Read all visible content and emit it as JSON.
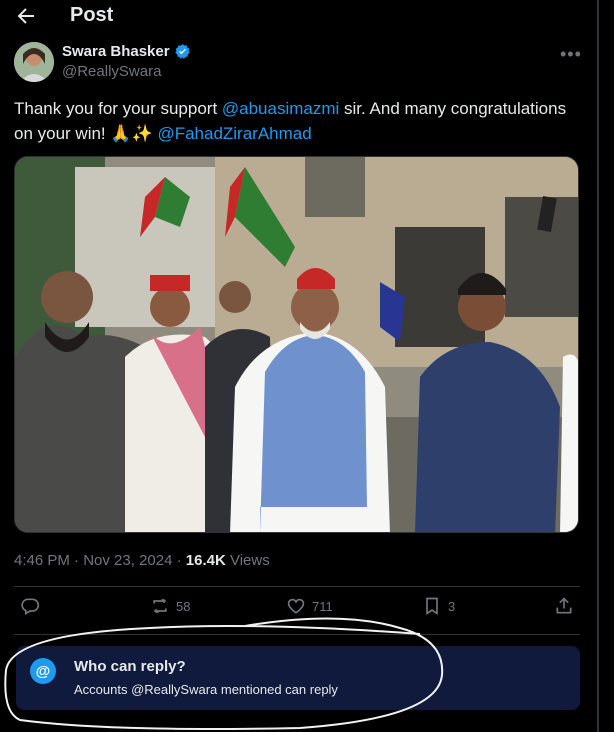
{
  "header": {
    "title": "Post",
    "back_icon": "arrow-left-icon"
  },
  "author": {
    "name": "Swara Bhasker",
    "handle": "@ReallySwara",
    "verified": true
  },
  "tweet": {
    "text_1": "Thank you for your support ",
    "mention_1": "@abuasimazmi",
    "text_2": " sir. And many congratulations on your win! 🙏✨ ",
    "mention_2": "@FahadZirarAhmad"
  },
  "meta": {
    "time": "4:46 PM",
    "sep1": " · ",
    "date": "Nov 23, 2024",
    "sep2": " · ",
    "views_count": "16.4K",
    "views_label": " Views"
  },
  "actions": {
    "replies": "",
    "retweets": "58",
    "likes": "711",
    "bookmarks": "3"
  },
  "reply_restriction": {
    "icon": "@",
    "title": "Who can reply?",
    "subtitle": "Accounts @ReallySwara mentioned can reply"
  },
  "colors": {
    "accent": "#1d9bf0",
    "background": "#000000",
    "secondary_text": "#71767b",
    "reply_box": "#0f1a3c"
  }
}
